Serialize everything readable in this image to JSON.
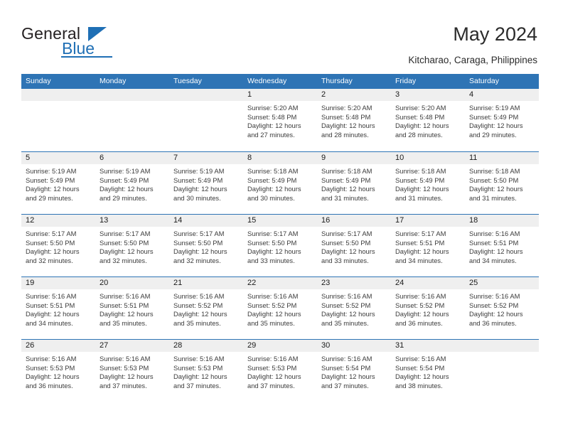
{
  "brand": {
    "name_part1": "General",
    "name_part2": "Blue",
    "accent_color": "#1f6fb5"
  },
  "header": {
    "title": "May 2024",
    "subtitle": "Kitcharao, Caraga, Philippines"
  },
  "theme": {
    "header_row_color": "#2e74b5",
    "day_band_color": "#efefef",
    "text_color": "#3b3b3b"
  },
  "calendar": {
    "weekdays": [
      "Sunday",
      "Monday",
      "Tuesday",
      "Wednesday",
      "Thursday",
      "Friday",
      "Saturday"
    ],
    "weeks": [
      [
        {
          "day": "",
          "sunrise": "",
          "sunset": "",
          "daylight_line1": "",
          "daylight_line2": "",
          "empty": true
        },
        {
          "day": "",
          "sunrise": "",
          "sunset": "",
          "daylight_line1": "",
          "daylight_line2": "",
          "empty": true
        },
        {
          "day": "",
          "sunrise": "",
          "sunset": "",
          "daylight_line1": "",
          "daylight_line2": "",
          "empty": true
        },
        {
          "day": "1",
          "sunrise": "Sunrise: 5:20 AM",
          "sunset": "Sunset: 5:48 PM",
          "daylight_line1": "Daylight: 12 hours",
          "daylight_line2": "and 27 minutes."
        },
        {
          "day": "2",
          "sunrise": "Sunrise: 5:20 AM",
          "sunset": "Sunset: 5:48 PM",
          "daylight_line1": "Daylight: 12 hours",
          "daylight_line2": "and 28 minutes."
        },
        {
          "day": "3",
          "sunrise": "Sunrise: 5:20 AM",
          "sunset": "Sunset: 5:48 PM",
          "daylight_line1": "Daylight: 12 hours",
          "daylight_line2": "and 28 minutes."
        },
        {
          "day": "4",
          "sunrise": "Sunrise: 5:19 AM",
          "sunset": "Sunset: 5:49 PM",
          "daylight_line1": "Daylight: 12 hours",
          "daylight_line2": "and 29 minutes."
        }
      ],
      [
        {
          "day": "5",
          "sunrise": "Sunrise: 5:19 AM",
          "sunset": "Sunset: 5:49 PM",
          "daylight_line1": "Daylight: 12 hours",
          "daylight_line2": "and 29 minutes."
        },
        {
          "day": "6",
          "sunrise": "Sunrise: 5:19 AM",
          "sunset": "Sunset: 5:49 PM",
          "daylight_line1": "Daylight: 12 hours",
          "daylight_line2": "and 29 minutes."
        },
        {
          "day": "7",
          "sunrise": "Sunrise: 5:19 AM",
          "sunset": "Sunset: 5:49 PM",
          "daylight_line1": "Daylight: 12 hours",
          "daylight_line2": "and 30 minutes."
        },
        {
          "day": "8",
          "sunrise": "Sunrise: 5:18 AM",
          "sunset": "Sunset: 5:49 PM",
          "daylight_line1": "Daylight: 12 hours",
          "daylight_line2": "and 30 minutes."
        },
        {
          "day": "9",
          "sunrise": "Sunrise: 5:18 AM",
          "sunset": "Sunset: 5:49 PM",
          "daylight_line1": "Daylight: 12 hours",
          "daylight_line2": "and 31 minutes."
        },
        {
          "day": "10",
          "sunrise": "Sunrise: 5:18 AM",
          "sunset": "Sunset: 5:49 PM",
          "daylight_line1": "Daylight: 12 hours",
          "daylight_line2": "and 31 minutes."
        },
        {
          "day": "11",
          "sunrise": "Sunrise: 5:18 AM",
          "sunset": "Sunset: 5:50 PM",
          "daylight_line1": "Daylight: 12 hours",
          "daylight_line2": "and 31 minutes."
        }
      ],
      [
        {
          "day": "12",
          "sunrise": "Sunrise: 5:17 AM",
          "sunset": "Sunset: 5:50 PM",
          "daylight_line1": "Daylight: 12 hours",
          "daylight_line2": "and 32 minutes."
        },
        {
          "day": "13",
          "sunrise": "Sunrise: 5:17 AM",
          "sunset": "Sunset: 5:50 PM",
          "daylight_line1": "Daylight: 12 hours",
          "daylight_line2": "and 32 minutes."
        },
        {
          "day": "14",
          "sunrise": "Sunrise: 5:17 AM",
          "sunset": "Sunset: 5:50 PM",
          "daylight_line1": "Daylight: 12 hours",
          "daylight_line2": "and 32 minutes."
        },
        {
          "day": "15",
          "sunrise": "Sunrise: 5:17 AM",
          "sunset": "Sunset: 5:50 PM",
          "daylight_line1": "Daylight: 12 hours",
          "daylight_line2": "and 33 minutes."
        },
        {
          "day": "16",
          "sunrise": "Sunrise: 5:17 AM",
          "sunset": "Sunset: 5:50 PM",
          "daylight_line1": "Daylight: 12 hours",
          "daylight_line2": "and 33 minutes."
        },
        {
          "day": "17",
          "sunrise": "Sunrise: 5:17 AM",
          "sunset": "Sunset: 5:51 PM",
          "daylight_line1": "Daylight: 12 hours",
          "daylight_line2": "and 34 minutes."
        },
        {
          "day": "18",
          "sunrise": "Sunrise: 5:16 AM",
          "sunset": "Sunset: 5:51 PM",
          "daylight_line1": "Daylight: 12 hours",
          "daylight_line2": "and 34 minutes."
        }
      ],
      [
        {
          "day": "19",
          "sunrise": "Sunrise: 5:16 AM",
          "sunset": "Sunset: 5:51 PM",
          "daylight_line1": "Daylight: 12 hours",
          "daylight_line2": "and 34 minutes."
        },
        {
          "day": "20",
          "sunrise": "Sunrise: 5:16 AM",
          "sunset": "Sunset: 5:51 PM",
          "daylight_line1": "Daylight: 12 hours",
          "daylight_line2": "and 35 minutes."
        },
        {
          "day": "21",
          "sunrise": "Sunrise: 5:16 AM",
          "sunset": "Sunset: 5:52 PM",
          "daylight_line1": "Daylight: 12 hours",
          "daylight_line2": "and 35 minutes."
        },
        {
          "day": "22",
          "sunrise": "Sunrise: 5:16 AM",
          "sunset": "Sunset: 5:52 PM",
          "daylight_line1": "Daylight: 12 hours",
          "daylight_line2": "and 35 minutes."
        },
        {
          "day": "23",
          "sunrise": "Sunrise: 5:16 AM",
          "sunset": "Sunset: 5:52 PM",
          "daylight_line1": "Daylight: 12 hours",
          "daylight_line2": "and 35 minutes."
        },
        {
          "day": "24",
          "sunrise": "Sunrise: 5:16 AM",
          "sunset": "Sunset: 5:52 PM",
          "daylight_line1": "Daylight: 12 hours",
          "daylight_line2": "and 36 minutes."
        },
        {
          "day": "25",
          "sunrise": "Sunrise: 5:16 AM",
          "sunset": "Sunset: 5:52 PM",
          "daylight_line1": "Daylight: 12 hours",
          "daylight_line2": "and 36 minutes."
        }
      ],
      [
        {
          "day": "26",
          "sunrise": "Sunrise: 5:16 AM",
          "sunset": "Sunset: 5:53 PM",
          "daylight_line1": "Daylight: 12 hours",
          "daylight_line2": "and 36 minutes."
        },
        {
          "day": "27",
          "sunrise": "Sunrise: 5:16 AM",
          "sunset": "Sunset: 5:53 PM",
          "daylight_line1": "Daylight: 12 hours",
          "daylight_line2": "and 37 minutes."
        },
        {
          "day": "28",
          "sunrise": "Sunrise: 5:16 AM",
          "sunset": "Sunset: 5:53 PM",
          "daylight_line1": "Daylight: 12 hours",
          "daylight_line2": "and 37 minutes."
        },
        {
          "day": "29",
          "sunrise": "Sunrise: 5:16 AM",
          "sunset": "Sunset: 5:53 PM",
          "daylight_line1": "Daylight: 12 hours",
          "daylight_line2": "and 37 minutes."
        },
        {
          "day": "30",
          "sunrise": "Sunrise: 5:16 AM",
          "sunset": "Sunset: 5:54 PM",
          "daylight_line1": "Daylight: 12 hours",
          "daylight_line2": "and 37 minutes."
        },
        {
          "day": "31",
          "sunrise": "Sunrise: 5:16 AM",
          "sunset": "Sunset: 5:54 PM",
          "daylight_line1": "Daylight: 12 hours",
          "daylight_line2": "and 38 minutes."
        },
        {
          "day": "",
          "sunrise": "",
          "sunset": "",
          "daylight_line1": "",
          "daylight_line2": "",
          "empty": true
        }
      ]
    ]
  }
}
